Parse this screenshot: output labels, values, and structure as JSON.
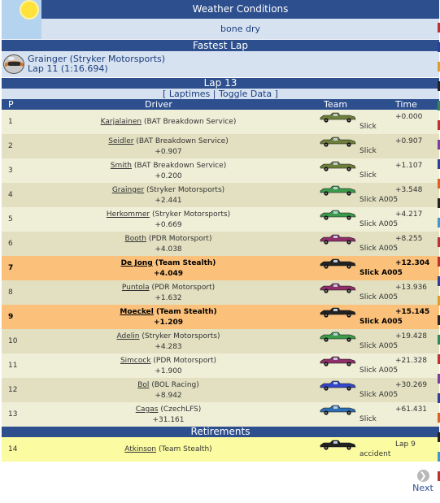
{
  "weather": {
    "title": "Weather Conditions",
    "value": "bone dry",
    "icon": "sun-icon"
  },
  "fastest": {
    "title": "Fastest Lap",
    "driver": "Grainger (Stryker Motorsports)",
    "lap": "Lap 11 (1:16.694)",
    "icon": "helmet-icon"
  },
  "lap": {
    "title": "Lap 13",
    "open": "[",
    "laptimes": "Laptimes",
    "sep": "|",
    "toggle": "Toggle Data",
    "close": "]"
  },
  "columns": {
    "p": "P",
    "driver": "Driver",
    "team": "Team",
    "time": "Time"
  },
  "rows": [
    {
      "p": "1",
      "name": "Karjalainen",
      "team": "(BAT Breakdown Service)",
      "gap": "",
      "car": "#6e7f3c",
      "tyre": "Slick",
      "time": "+0.000",
      "style": "odd"
    },
    {
      "p": "2",
      "name": "Seidler",
      "team": "(BAT Breakdown Service)",
      "gap": "+0.907",
      "car": "#6e7f3c",
      "tyre": "Slick",
      "time": "+0.907",
      "style": "even"
    },
    {
      "p": "3",
      "name": "Smith",
      "team": "(BAT Breakdown Service)",
      "gap": "+0.200",
      "car": "#6e7f3c",
      "tyre": "Slick",
      "time": "+1.107",
      "style": "odd"
    },
    {
      "p": "4",
      "name": "Grainger",
      "team": "(Stryker Motorsports)",
      "gap": "+2.441",
      "car": "#3c9a4b",
      "tyre": "Slick A005",
      "time": "+3.548",
      "style": "even"
    },
    {
      "p": "5",
      "name": "Herkommer",
      "team": "(Stryker Motorsports)",
      "gap": "+0.669",
      "car": "#3c9a4b",
      "tyre": "Slick A005",
      "time": "+4.217",
      "style": "odd"
    },
    {
      "p": "6",
      "name": "Booth",
      "team": "(PDR Motorsport)",
      "gap": "+4.038",
      "car": "#8e2f6a",
      "tyre": "Slick A005",
      "time": "+8.255",
      "style": "even"
    },
    {
      "p": "7",
      "name": "De Jong",
      "team": "(Team Stealth)",
      "gap": "+4.049",
      "car": "#222222",
      "tyre": "Slick A005",
      "time": "+12.304",
      "style": "hl"
    },
    {
      "p": "8",
      "name": "Puntola",
      "team": "(PDR Motorsport)",
      "gap": "+1.632",
      "car": "#8e2f6a",
      "tyre": "Slick A005",
      "time": "+13.936",
      "style": "even"
    },
    {
      "p": "9",
      "name": "Moeckel",
      "team": "(Team Stealth)",
      "gap": "+1.209",
      "car": "#222222",
      "tyre": "Slick A005",
      "time": "+15.145",
      "style": "hl"
    },
    {
      "p": "10",
      "name": "Adelin",
      "team": "(Stryker Motorsports)",
      "gap": "+4.283",
      "car": "#3c9a4b",
      "tyre": "Slick A005",
      "time": "+19.428",
      "style": "even"
    },
    {
      "p": "11",
      "name": "Simcock",
      "team": "(PDR Motorsport)",
      "gap": "+1.900",
      "car": "#8e2f6a",
      "tyre": "Slick A005",
      "time": "+21.328",
      "style": "odd"
    },
    {
      "p": "12",
      "name": "Bol",
      "team": "(BOL Racing)",
      "gap": "+8.942",
      "car": "#3346c8",
      "tyre": "Slick A005",
      "time": "+30.269",
      "style": "even"
    },
    {
      "p": "13",
      "name": "Cagas",
      "team": "(CzechLFS)",
      "gap": "+31.161",
      "car": "#2f6fb0",
      "tyre": "Slick",
      "time": "+61.431",
      "style": "odd"
    }
  ],
  "retirements": {
    "title": "Retirements",
    "rows": [
      {
        "p": "14",
        "name": "Atkinson",
        "team": "(Team Stealth)",
        "gap": "",
        "car": "#222222",
        "tyre": "accident",
        "time": "Lap 9",
        "style": "ret"
      }
    ]
  },
  "next": {
    "label": "Next",
    "icon": "next-arrow-icon"
  }
}
